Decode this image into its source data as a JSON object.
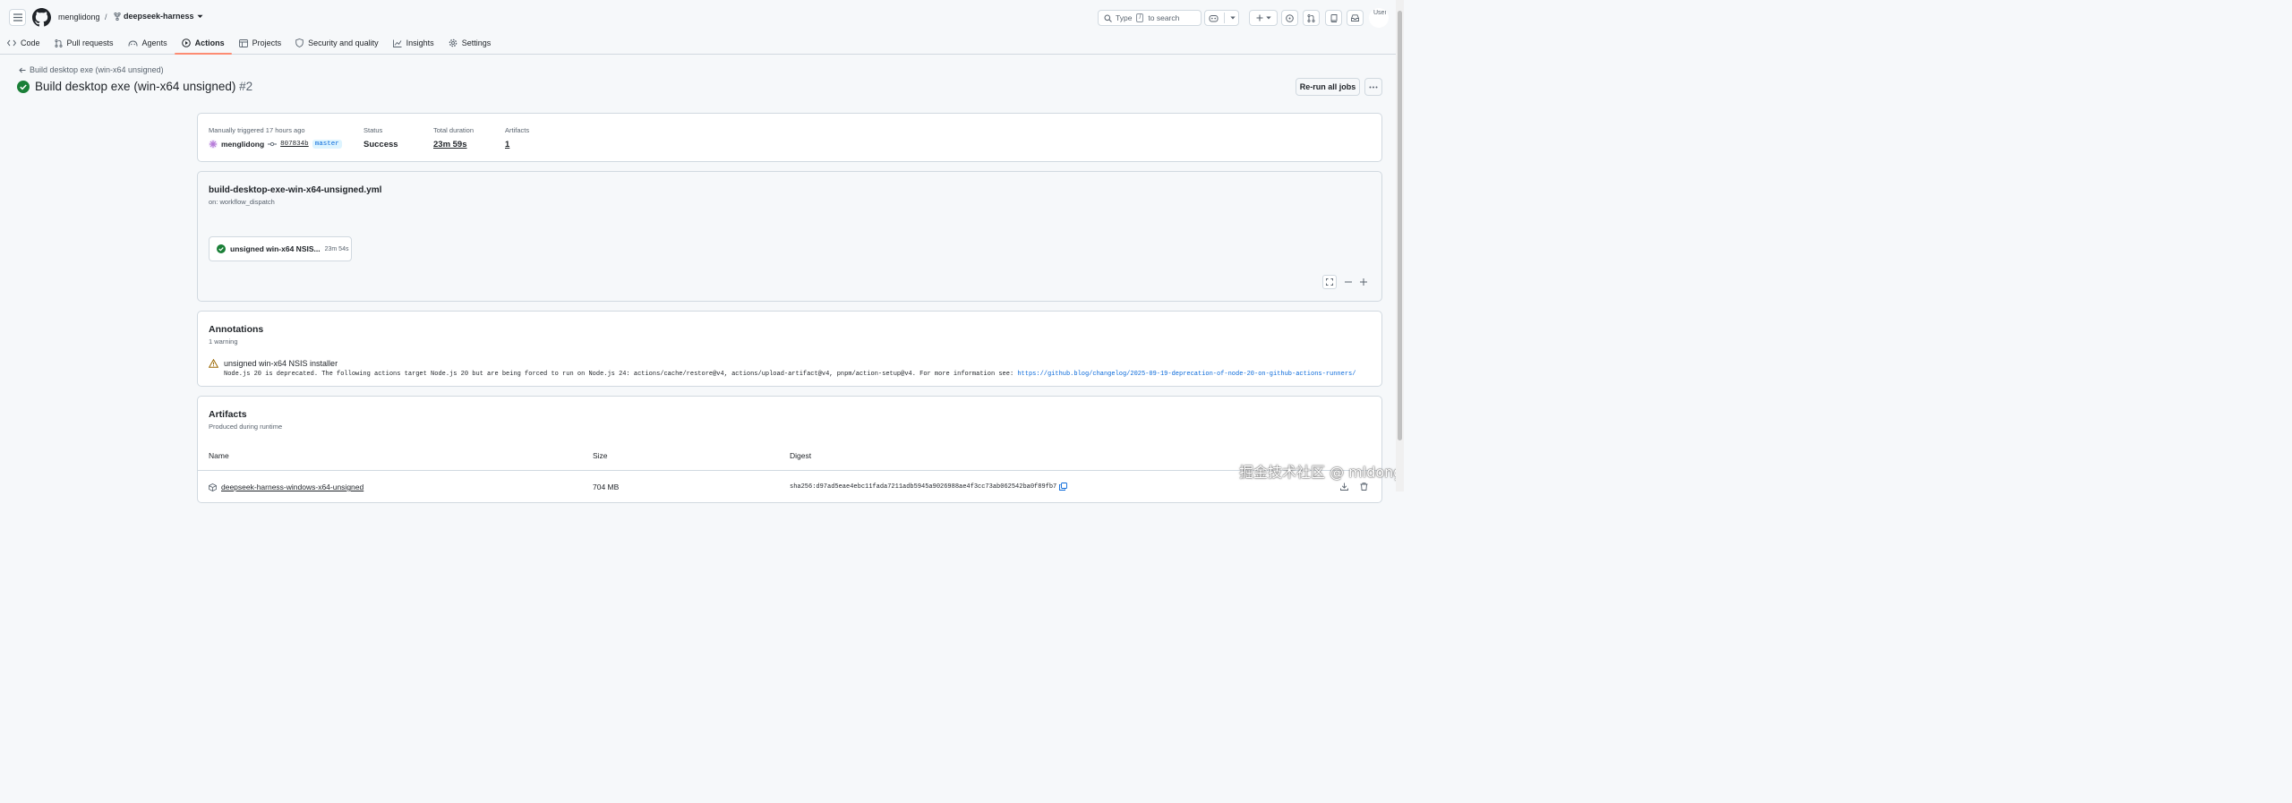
{
  "header": {
    "owner": "menglidong",
    "separator": "/",
    "repo": "deepseek-harness",
    "search": {
      "prefix": "Type",
      "key": "/",
      "suffix": "to search"
    },
    "avatar_alt": "User"
  },
  "tabs": [
    {
      "label": "Code",
      "icon": "code-icon"
    },
    {
      "label": "Pull requests",
      "icon": "pull-request-icon"
    },
    {
      "label": "Agents",
      "icon": "agents-icon"
    },
    {
      "label": "Actions",
      "icon": "play-icon",
      "active": true
    },
    {
      "label": "Projects",
      "icon": "table-icon"
    },
    {
      "label": "Security and quality",
      "icon": "shield-icon"
    },
    {
      "label": "Insights",
      "icon": "graph-icon"
    },
    {
      "label": "Settings",
      "icon": "gear-icon"
    }
  ],
  "run": {
    "back_label": "Build desktop exe (win-x64 unsigned)",
    "title": "Build desktop exe (win-x64 unsigned)",
    "number": "#2",
    "rerun_label": "Re-run all jobs"
  },
  "summary": {
    "trigger_label": "Manually triggered 17 hours ago",
    "actor": "menglidong",
    "commit_sha": "807834b",
    "branch": "master",
    "status_label": "Status",
    "status_value": "Success",
    "duration_label": "Total duration",
    "duration_value": "23m 59s",
    "artifacts_label": "Artifacts",
    "artifacts_value": "1"
  },
  "workflow": {
    "file": "build-desktop-exe-win-x64-unsigned.yml",
    "trigger": "on: workflow_dispatch",
    "job_name": "unsigned win-x64 NSIS...",
    "job_duration": "23m 54s"
  },
  "annotations": {
    "title": "Annotations",
    "count": "1 warning",
    "warning_title": "unsigned win-x64 NSIS installer",
    "warning_message": "Node.js 20 is deprecated. The following actions target Node.js 20 but are being forced to run on Node.js 24: actions/cache/restore@v4, actions/upload-artifact@v4, pnpm/action-setup@v4. For more information see: ",
    "warning_link": "https://github.blog/changelog/2025-09-19-deprecation-of-node-20-on-github-actions-runners/"
  },
  "artifacts": {
    "title": "Artifacts",
    "subtitle": "Produced during runtime",
    "columns": [
      "Name",
      "Size",
      "Digest"
    ],
    "rows": [
      {
        "name": "deepseek-harness-windows-x64-unsigned",
        "size": "704 MB",
        "digest": "sha256:d97ad5eae4ebc11fada7211adb5945a9026988ae4f3cc73ab062542ba0f89fb7"
      }
    ]
  },
  "watermark": "掘金技术社区 @ mldong",
  "colors": {
    "success": "#1a7f37",
    "warning": "#9a6700",
    "accent": "#0969da",
    "active_tab": "#fd8c73"
  }
}
